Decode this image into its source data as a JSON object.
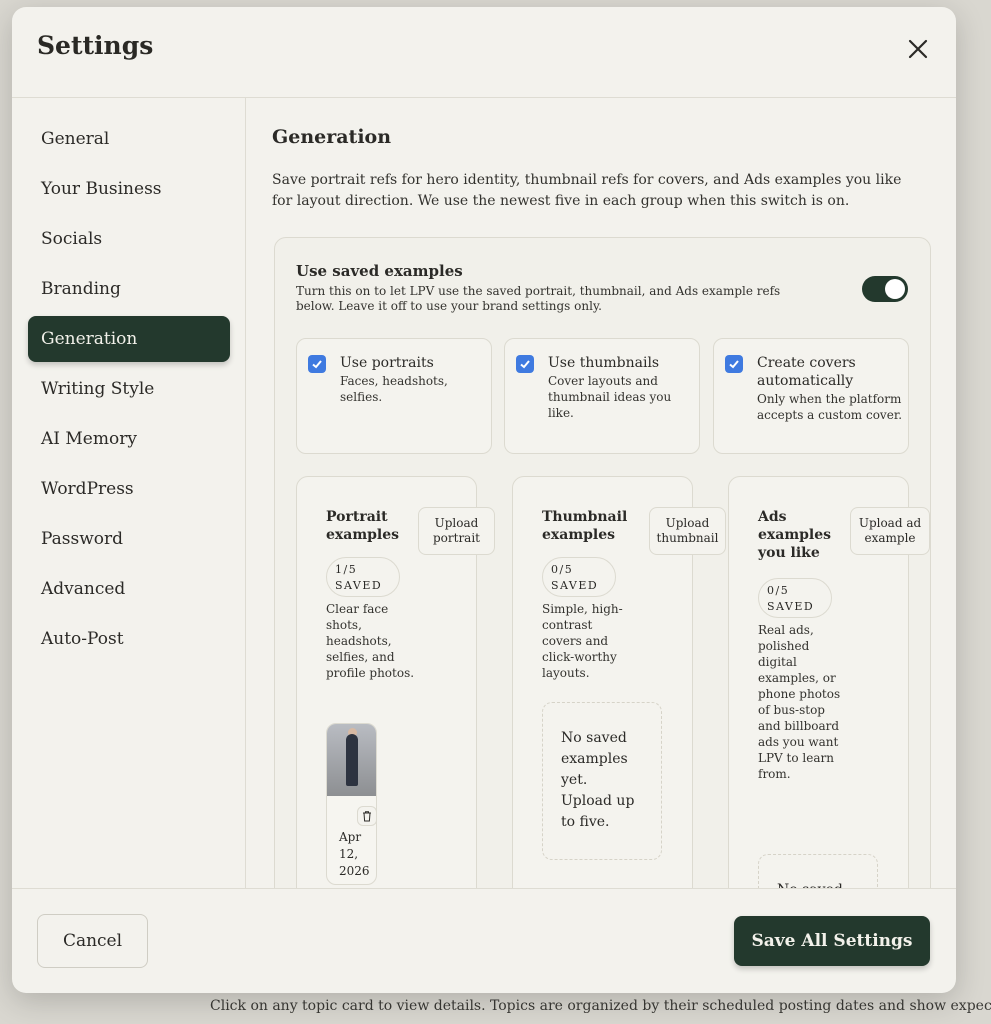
{
  "background": {
    "footer_text": "Click on any topic card to view details. Topics are organized by their scheduled posting dates and show expected"
  },
  "modal": {
    "title": "Settings",
    "close_label": "×"
  },
  "sidebar": {
    "items": [
      {
        "label": "General",
        "active": false
      },
      {
        "label": "Your Business",
        "active": false
      },
      {
        "label": "Socials",
        "active": false
      },
      {
        "label": "Branding",
        "active": false
      },
      {
        "label": "Generation",
        "active": true
      },
      {
        "label": "Writing Style",
        "active": false
      },
      {
        "label": "AI Memory",
        "active": false
      },
      {
        "label": "WordPress",
        "active": false
      },
      {
        "label": "Password",
        "active": false
      },
      {
        "label": "Advanced",
        "active": false
      },
      {
        "label": "Auto-Post",
        "active": false
      }
    ]
  },
  "content": {
    "title": "Generation",
    "description": "Save portrait refs for hero identity, thumbnail refs for covers, and Ads examples you like for layout direction. We use the newest five in each group when this switch is on.",
    "saved_examples": {
      "title": "Use saved examples",
      "description": "Turn this on to let LPV use the saved portrait, thumbnail, and Ads example refs below. Leave it off to use your brand settings only.",
      "enabled": true
    },
    "options": [
      {
        "title": "Use portraits",
        "description": "Faces, headshots, selfies.",
        "checked": true
      },
      {
        "title": "Use thumbnails",
        "description": "Cover layouts and thumbnail ideas you like.",
        "checked": true
      },
      {
        "title": "Create covers automatically",
        "description": "Only when the platform accepts a custom cover.",
        "checked": true
      }
    ],
    "groups": [
      {
        "title": "Portrait examples",
        "upload_label": "Upload portrait",
        "saved_count": "1/5",
        "saved_label": "SAVED",
        "description": "Clear face shots, headshots, selfies, and profile photos.",
        "items": [
          {
            "date": "Apr 12, 2026"
          }
        ]
      },
      {
        "title": "Thumbnail examples",
        "upload_label": "Upload thumbnail",
        "saved_count": "0/5",
        "saved_label": "SAVED",
        "description": "Simple, high-contrast covers and click-worthy layouts.",
        "empty_title": "No saved examples yet.",
        "empty_hint": "Upload up to five."
      },
      {
        "title": "Ads examples you like",
        "upload_label": "Upload ad example",
        "saved_count": "0/5",
        "saved_label": "SAVED",
        "description": "Real ads, polished digital examples, or phone photos of bus-stop and billboard ads you want LPV to learn from.",
        "empty_title": "No saved"
      }
    ]
  },
  "footer": {
    "cancel_label": "Cancel",
    "save_label": "Save All Settings"
  },
  "colors": {
    "accent": "#23392d",
    "checkbox": "#3f7ae0",
    "panel": "#f3f2ed"
  }
}
